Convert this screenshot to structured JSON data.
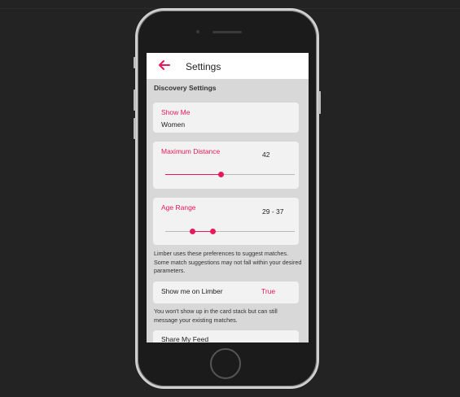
{
  "topbar": {
    "title": "Settings",
    "back_icon": "back-arrow-icon",
    "accent_color": "#e8185a"
  },
  "discovery": {
    "section_title": "Discovery Settings",
    "show_me": {
      "label": "Show Me",
      "value": "Women"
    },
    "max_distance": {
      "label": "Maximum Distance",
      "value": "42",
      "fraction": 0.43
    },
    "age_range": {
      "label": "Age Range",
      "value": "29 - 37",
      "low_fraction": 0.21,
      "high_fraction": 0.37
    },
    "note": "Limber uses these preferences to suggest matches. Some match suggestions may not fall within your desired parameters."
  },
  "visibility": {
    "label": "Show me on Limber",
    "value": "True",
    "note": "You won't show up in the card stack but can still message your existing matches."
  },
  "feed": {
    "label": "Share My Feed"
  }
}
